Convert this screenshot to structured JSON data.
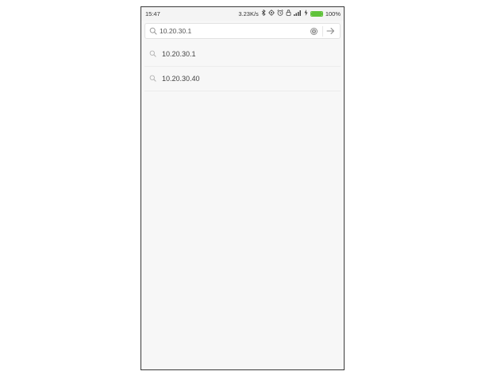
{
  "status_bar": {
    "time": "15:47",
    "network_speed": "3.23K/s",
    "icons": [
      "bluetooth-icon",
      "gps-icon",
      "alarm-icon",
      "lock-icon",
      "signal-icon",
      "charging-icon",
      "battery-icon"
    ],
    "battery_percent": "100%",
    "battery_level": 1.0,
    "battery_color": "#5fc23a"
  },
  "search": {
    "value": "10.20.30.1",
    "placeholder": "",
    "icons": {
      "left": "search-icon",
      "clear": "clear-icon",
      "submit": "arrow-right-icon"
    }
  },
  "suggestions": [
    {
      "label": "10.20.30.1",
      "icon": "search-icon"
    },
    {
      "label": "10.20.30.40",
      "icon": "search-icon"
    }
  ]
}
